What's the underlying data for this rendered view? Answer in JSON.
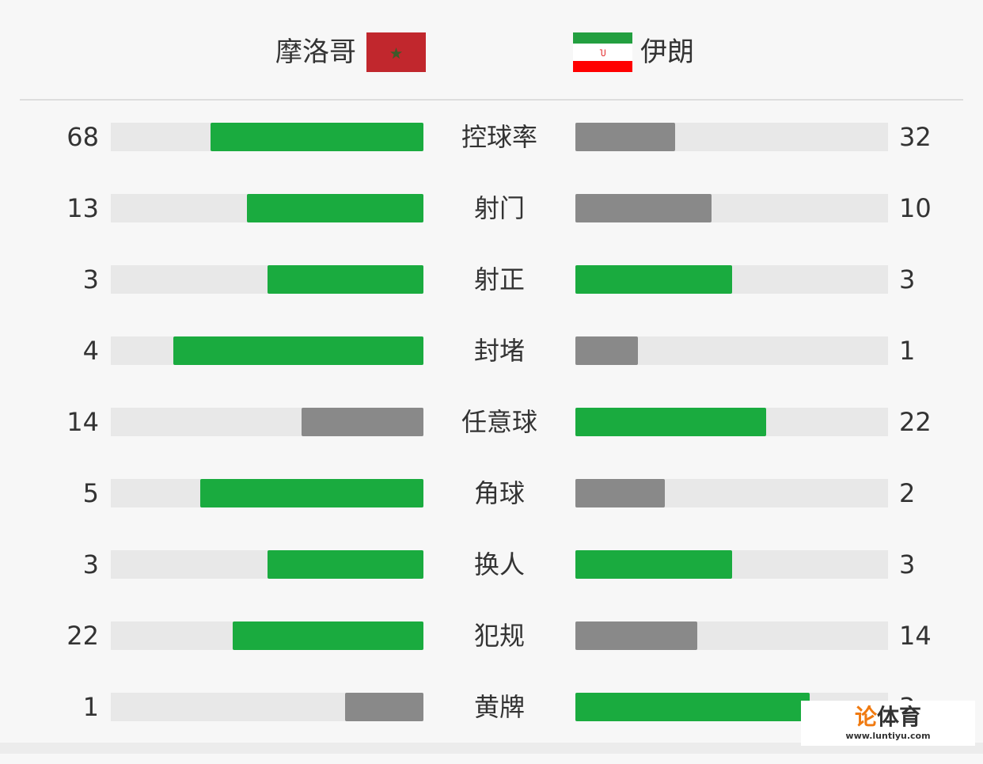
{
  "home": {
    "name": "摩洛哥",
    "flag": "morocco-flag"
  },
  "away": {
    "name": "伊朗",
    "flag": "iran-flag"
  },
  "colors": {
    "win": "#1aab3f",
    "lose": "#898989",
    "track": "#e8e8e8"
  },
  "stats": [
    {
      "label": "控球率",
      "home": "68",
      "away": "32"
    },
    {
      "label": "射门",
      "home": "13",
      "away": "10"
    },
    {
      "label": "射正",
      "home": "3",
      "away": "3"
    },
    {
      "label": "封堵",
      "home": "4",
      "away": "1"
    },
    {
      "label": "任意球",
      "home": "14",
      "away": "22"
    },
    {
      "label": "角球",
      "home": "5",
      "away": "2"
    },
    {
      "label": "换人",
      "home": "3",
      "away": "3"
    },
    {
      "label": "犯规",
      "home": "22",
      "away": "14"
    },
    {
      "label": "黄牌",
      "home": "1",
      "away": "3"
    }
  ],
  "watermark": {
    "brand_orange": "论",
    "brand_dark": "体育",
    "url": "www.luntiyu.com"
  }
}
